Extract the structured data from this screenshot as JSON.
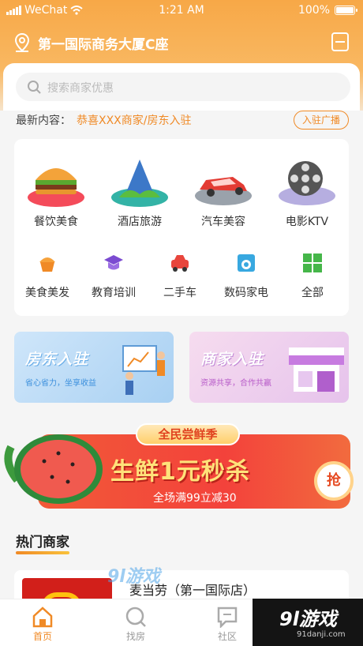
{
  "status_bar": {
    "carrier": "WeChat",
    "time": "1:21 AM",
    "battery": "100%",
    "battery_level": 1.0
  },
  "header": {
    "location": "第一国际商务大厦C座",
    "location_icon": "location-pin-icon",
    "scan_icon": "scan-icon"
  },
  "search": {
    "placeholder": "搜索商家优惠",
    "icon": "search-icon"
  },
  "news": {
    "prefix": "最新内容：",
    "text": "恭喜XXX商家/房东入驻",
    "button": "入驻广播"
  },
  "categories_main": [
    {
      "label": "餐饮美食",
      "icon": "burger-icon"
    },
    {
      "label": "酒店旅游",
      "icon": "island-icon"
    },
    {
      "label": "汽车美容",
      "icon": "car-icon"
    },
    {
      "label": "电影KTV",
      "icon": "film-reel-icon"
    }
  ],
  "categories_sub": [
    {
      "label": "美食美发",
      "icon": "cupcake-icon"
    },
    {
      "label": "教育培训",
      "icon": "graduation-cap-icon"
    },
    {
      "label": "二手车",
      "icon": "car-small-icon"
    },
    {
      "label": "数码家电",
      "icon": "washing-machine-icon"
    },
    {
      "label": "全部",
      "icon": "grid-icon"
    }
  ],
  "banners": [
    {
      "title": "房东入驻",
      "subtitle": "省心省力，坐享收益"
    },
    {
      "title": "商家入驻",
      "subtitle": "资源共享，合作共赢"
    }
  ],
  "promo": {
    "tag": "全民尝鲜季",
    "title": "生鲜1元秒杀",
    "subtitle": "全场满99立减30",
    "button": "抢"
  },
  "section": {
    "title": "热门商家"
  },
  "merchant": {
    "name": "麦当劳（第一国际店）"
  },
  "watermark": {
    "mid": "9l游戏",
    "brand": "9l游戏",
    "url": "91danji.com"
  },
  "tabs": [
    {
      "label": "首页",
      "icon": "home-icon",
      "active": true
    },
    {
      "label": "找房",
      "icon": "search-house-icon",
      "active": false
    },
    {
      "label": "社区",
      "icon": "chat-icon",
      "active": false
    }
  ],
  "colors": {
    "accent": "#f08a26",
    "header_bg": "#f7a847",
    "promo_red": "#f3423b"
  }
}
